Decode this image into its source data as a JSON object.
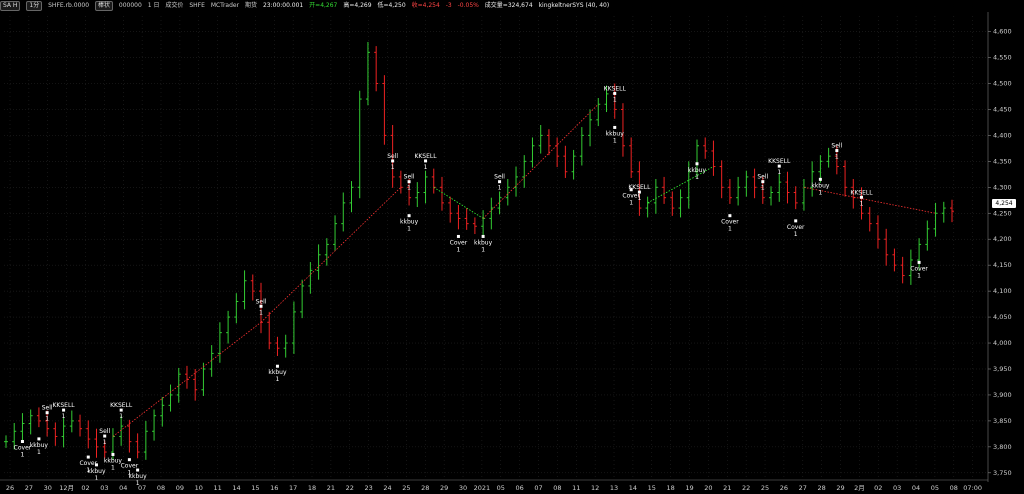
{
  "header": {
    "symbol_button": "SA H",
    "period_button": "1分",
    "symbol_name": "SHFE.rb.0000",
    "chart_type": "棒状",
    "setting_text": "000000",
    "interval_text": "1 日",
    "exchange_text": "成交价",
    "exchange_value": "SHFE",
    "source_text": "MCTrader",
    "period_label": "期货",
    "time_text": "23:00:00.001",
    "open_label": "开=4,267",
    "high_label": "高=4,269",
    "low_label": "低=4,250",
    "close_label": "收=4,254",
    "change_label": "-3",
    "pct_label": "-0.05%",
    "volume_label": "成交量=324,674",
    "strategy_label": "kingkeltnerSYS (40, 40)"
  },
  "colors": {
    "background": "#000000",
    "up": "#33cc33",
    "down": "#ee2222",
    "grid": "#2a2a2a",
    "trend": "#ff3333",
    "dotted_green": "#33ff33"
  },
  "price_axis": {
    "ticks": [
      "4,600",
      "4,550",
      "4,500",
      "4,450",
      "4,400",
      "4,350",
      "4,300",
      "4,250",
      "4,200",
      "4,150",
      "4,100",
      "4,050",
      "4,000",
      "3,950",
      "3,900",
      "3,850",
      "3,800",
      "3,750"
    ],
    "current_price": "4,254"
  },
  "date_axis": {
    "labels": [
      "26",
      "27",
      "30",
      "12月",
      "02",
      "03",
      "04",
      "07",
      "08",
      "09",
      "10",
      "11",
      "14",
      "15",
      "16",
      "17",
      "18",
      "21",
      "22",
      "23",
      "24",
      "25",
      "28",
      "29",
      "30",
      "2021",
      "05",
      "06",
      "07",
      "08",
      "11",
      "12",
      "13",
      "14",
      "15",
      "18",
      "19",
      "20",
      "21",
      "22",
      "25",
      "26",
      "27",
      "28",
      "29",
      "2月",
      "02",
      "03",
      "04",
      "05",
      "08",
      "07:00"
    ]
  },
  "chart_data": {
    "type": "ohlc",
    "ylim": [
      3740,
      4630
    ],
    "ylabel": "",
    "xlabel": "",
    "series": [
      {
        "values_close": [
          3810,
          3830,
          3845,
          3860,
          3850,
          3835,
          3820,
          3840,
          3850,
          3835,
          3815,
          3800,
          3790,
          3820,
          3840,
          3810,
          3790,
          3830,
          3860,
          3880,
          3900,
          3940,
          3930,
          3910,
          3950,
          3980,
          4020,
          4050,
          4080,
          4120,
          4100,
          4040,
          4000,
          3990,
          4000,
          4060,
          4110,
          4140,
          4170,
          4190,
          4230,
          4270,
          4300,
          4470,
          4560,
          4500,
          4400,
          4320,
          4300,
          4280,
          4290,
          4320,
          4300,
          4270,
          4250,
          4240,
          4230,
          4225,
          4240,
          4260,
          4280,
          4300,
          4320,
          4350,
          4380,
          4400,
          4380,
          4360,
          4330,
          4360,
          4400,
          4430,
          4460,
          4480,
          4450,
          4380,
          4330,
          4260,
          4270,
          4300,
          4280,
          4260,
          4280,
          4330,
          4380,
          4370,
          4340,
          4300,
          4280,
          4300,
          4320,
          4300,
          4280,
          4290,
          4310,
          4290,
          4270,
          4300,
          4330,
          4350,
          4360,
          4340,
          4300,
          4280,
          4250,
          4230,
          4200,
          4170,
          4150,
          4130,
          4160,
          4190,
          4220,
          4250,
          4260,
          4254
        ]
      }
    ]
  },
  "signals": [
    {
      "label": "Cover",
      "qty": "1"
    },
    {
      "label": "kkbuy",
      "qty": "1"
    },
    {
      "label": "Sell",
      "qty": "1"
    },
    {
      "label": "KKSELL",
      "qty": "1"
    },
    {
      "label": "Cover",
      "qty": "1"
    },
    {
      "label": "kkbuy",
      "qty": "1"
    },
    {
      "label": "Sell",
      "qty": "1"
    },
    {
      "label": "kkbuy",
      "qty": "1"
    },
    {
      "label": "KKSELL",
      "qty": "1"
    },
    {
      "label": "Cover",
      "qty": "1"
    },
    {
      "label": "kkbuy",
      "qty": "1"
    },
    {
      "label": "Sell",
      "qty": "1"
    },
    {
      "label": "kkbuy",
      "qty": "1"
    },
    {
      "label": "Sell",
      "qty": "1"
    },
    {
      "label": "Sell",
      "qty": "1"
    },
    {
      "label": "kkbuy",
      "qty": "1"
    },
    {
      "label": "KKSELL",
      "qty": "1"
    },
    {
      "label": "Cover",
      "qty": "1"
    },
    {
      "label": "kkbuy",
      "qty": "1"
    },
    {
      "label": "Sell",
      "qty": "1"
    },
    {
      "label": "KKSELL",
      "qty": "1"
    },
    {
      "label": "kkbuy",
      "qty": "1"
    },
    {
      "label": "Cover",
      "qty": "1"
    },
    {
      "label": "KKSELL",
      "qty": "1"
    },
    {
      "label": "kkbuy",
      "qty": "1"
    },
    {
      "label": "Cover",
      "qty": "1"
    },
    {
      "label": "Sell",
      "qty": "1"
    },
    {
      "label": "KKSELL",
      "qty": "1"
    },
    {
      "label": "Cover",
      "qty": "1"
    },
    {
      "label": "kkbuy",
      "qty": "1"
    },
    {
      "label": "Sell",
      "qty": "1"
    },
    {
      "label": "KKSELL",
      "qty": "1"
    },
    {
      "label": "Cover",
      "qty": "1"
    }
  ]
}
